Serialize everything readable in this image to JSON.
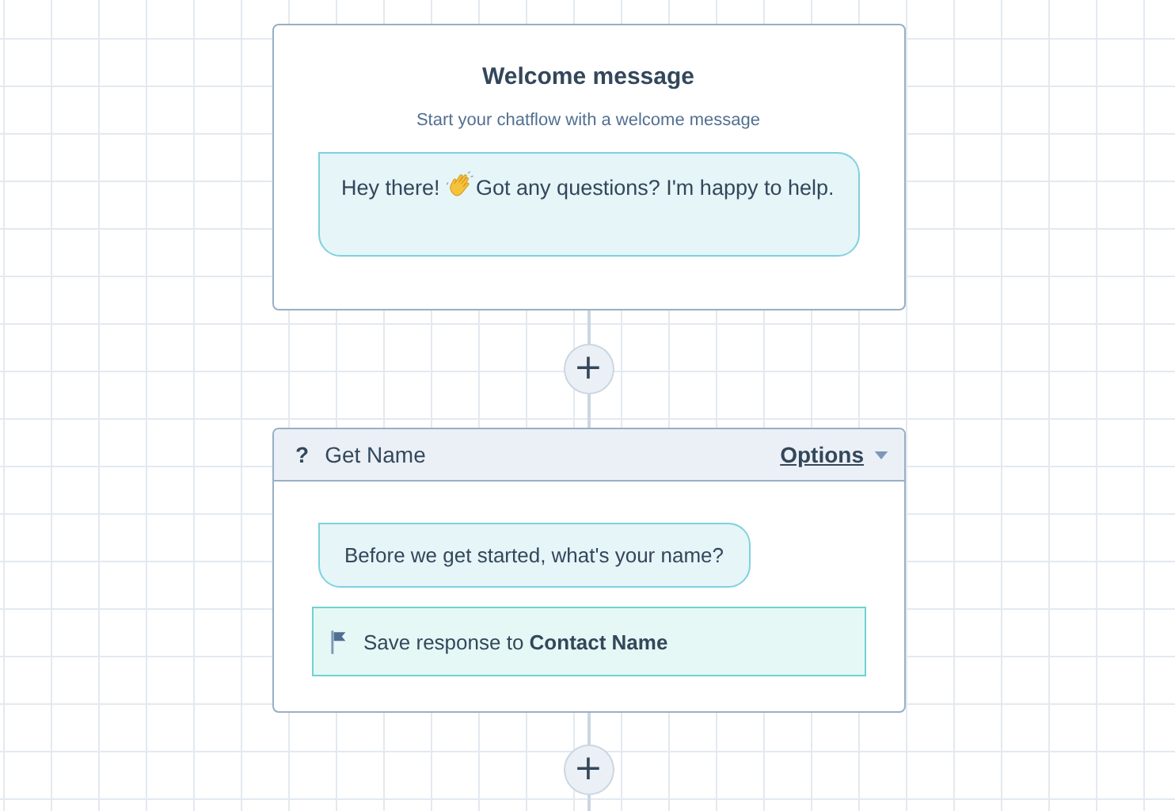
{
  "welcome": {
    "title": "Welcome message",
    "subtitle": "Start your chatflow with a welcome message",
    "message_before": "Hey there! ",
    "message_after": "Got any questions? I'm happy to help."
  },
  "add_buttons": [
    {
      "label": "+"
    },
    {
      "label": "+"
    }
  ],
  "question": {
    "icon": "?",
    "title": "Get Name",
    "options": "Options",
    "message": "Before we get started, what's your name?",
    "save_prefix": "Save response to ",
    "save_target": "Contact Name"
  }
}
